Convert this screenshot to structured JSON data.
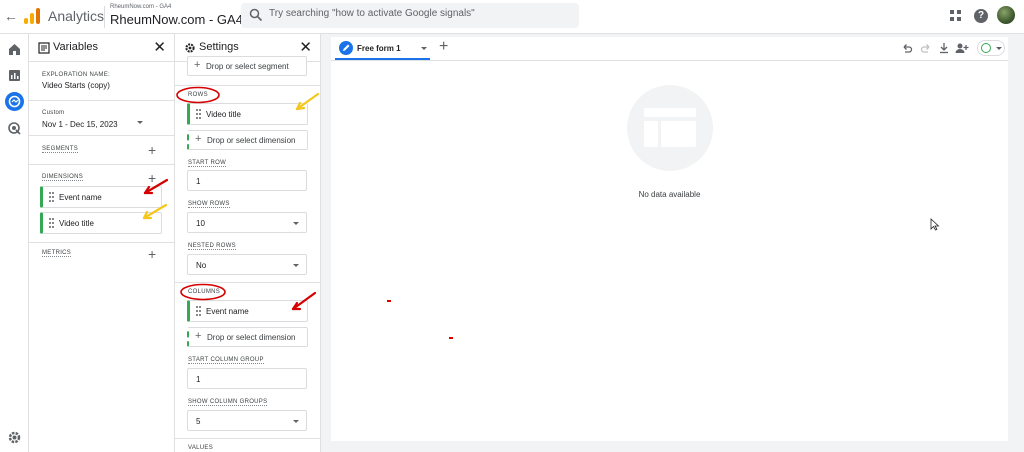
{
  "topbar": {
    "app_name": "Analytics",
    "account_small": "RheumNow.com - GA4",
    "account_name": "RheumNow.com - GA4",
    "search_placeholder": "Try searching \"how to activate Google signals\""
  },
  "icons": {
    "back": "arrow-left-icon",
    "logo": "analytics-logo",
    "search": "search-icon",
    "apps": "apps-grid-icon",
    "help": "help-icon",
    "rail": [
      "home-icon",
      "reports-icon",
      "explore-icon",
      "advertising-icon",
      "settings-icon"
    ]
  },
  "variables": {
    "title": "Variables",
    "exploration_label": "EXPLORATION NAME:",
    "exploration_name": "Video Starts (copy)",
    "date_label": "Custom",
    "date_range": "Nov 1 - Dec 15, 2023",
    "segments_label": "SEGMENTS",
    "dimensions_label": "DIMENSIONS",
    "dimensions": [
      "Event name",
      "Video title"
    ],
    "metrics_label": "METRICS"
  },
  "settings": {
    "title": "Settings",
    "segment_drop": "Drop or select segment",
    "rows_label": "ROWS",
    "rows_dimension": "Video title",
    "rows_drop": "Drop or select dimension",
    "start_row_label": "START ROW",
    "start_row": "1",
    "show_rows_label": "SHOW ROWS",
    "show_rows": "10",
    "nested_rows_label": "NESTED ROWS",
    "nested_rows": "No",
    "columns_label": "COLUMNS",
    "columns_dimension": "Event name",
    "columns_drop": "Drop or select dimension",
    "start_col_label": "START COLUMN GROUP",
    "start_col": "1",
    "show_col_label": "SHOW COLUMN GROUPS",
    "show_col": "5",
    "values_label": "VALUES"
  },
  "tab": {
    "label": "Free form 1"
  },
  "canvas": {
    "empty_text": "No data available"
  },
  "colors": {
    "accent": "#1a73e8",
    "chip_border": "#34a853",
    "annotation_red": "#d50000",
    "annotation_yellow": "#f6c71b"
  }
}
